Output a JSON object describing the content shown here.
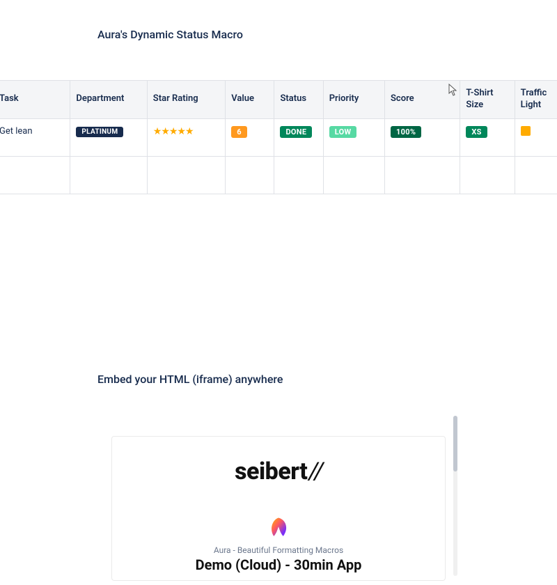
{
  "section1": {
    "title": "Aura's Dynamic Status Macro"
  },
  "table": {
    "headers": {
      "task": "Task",
      "department": "Department",
      "star": "Star Rating",
      "value": "Value",
      "status": "Status",
      "priority": "Priority",
      "score": "Score",
      "size": "T-Shirt Size",
      "light": "Traffic Light"
    },
    "row": {
      "task": "Get lean",
      "department": "PLATINUM",
      "stars": "★★★★★",
      "value": "6",
      "status": "DONE",
      "priority": "LOW",
      "score": "100%",
      "size": "XS"
    }
  },
  "section2": {
    "title": "Embed your HTML (iframe) anywhere"
  },
  "card": {
    "brand_main": "seibert",
    "brand_slash": "//",
    "subtitle": "Aura - Beautiful Formatting Macros",
    "demo_title": "Demo (Cloud) - 30min App"
  }
}
